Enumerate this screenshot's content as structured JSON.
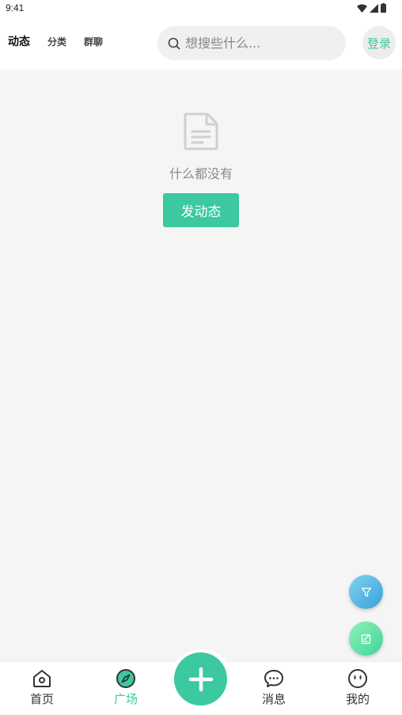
{
  "status_bar": {
    "time": "9:41"
  },
  "header": {
    "tabs": [
      {
        "label": "动态",
        "active": true
      },
      {
        "label": "分类",
        "active": false
      },
      {
        "label": "群聊",
        "active": false
      }
    ],
    "search": {
      "placeholder": "想搜些什么..."
    },
    "login_label": "登录"
  },
  "empty_state": {
    "icon": "document-icon",
    "message": "什么都没有",
    "button_label": "发动态"
  },
  "floating_buttons": [
    {
      "icon": "filter-icon"
    },
    {
      "icon": "edit-icon"
    }
  ],
  "bottom_nav": {
    "items": [
      {
        "label": "首页",
        "icon": "home-icon",
        "active": false
      },
      {
        "label": "广场",
        "icon": "compass-icon",
        "active": true
      },
      {
        "label": "消息",
        "icon": "chat-icon",
        "active": false
      },
      {
        "label": "我的",
        "icon": "profile-icon",
        "active": false
      }
    ],
    "center_icon": "plus-icon"
  },
  "colors": {
    "accent": "#3cc8a0",
    "background": "#f5f5f5"
  }
}
